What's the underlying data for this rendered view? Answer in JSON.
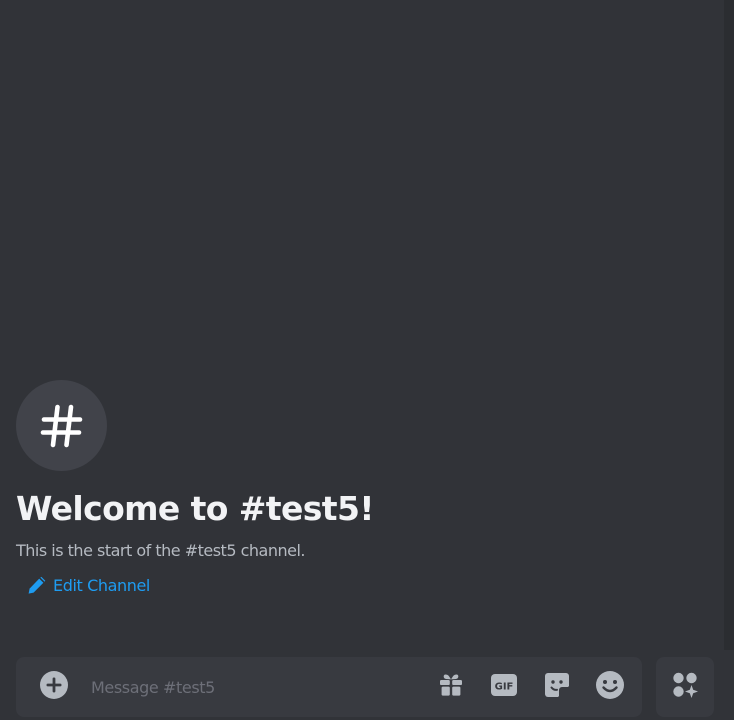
{
  "channel": {
    "welcome_title": "Welcome to #test5!",
    "welcome_subtitle": "This is the start of the #test5 channel.",
    "edit_label": "Edit Channel",
    "hash_icon": "hash-icon"
  },
  "composer": {
    "placeholder": "Message #test5",
    "value": "",
    "icons": [
      "plus-circle-icon",
      "gift-icon",
      "gif-icon",
      "sticker-icon",
      "emoji-icon",
      "apps-icon"
    ],
    "gif_label": "GIF"
  },
  "colors": {
    "background": "#313338",
    "composer_bg": "#383a40",
    "accent_link": "#1e9cf1",
    "heading": "#f2f3f5",
    "muted": "#b5bac1",
    "icon": "#b5bac1"
  }
}
